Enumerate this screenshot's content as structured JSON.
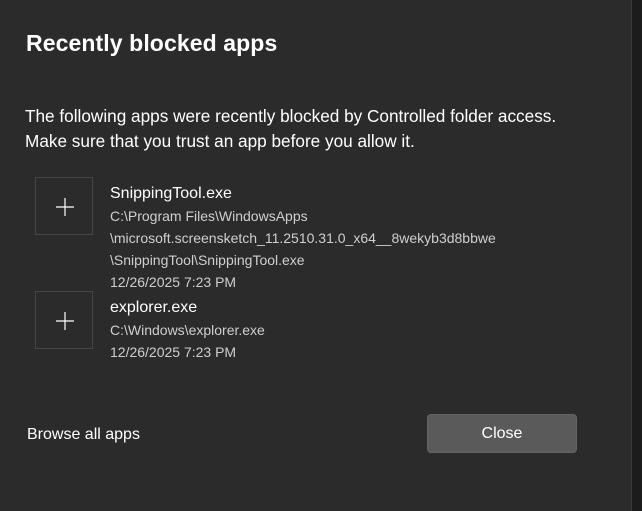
{
  "dialog": {
    "title": "Recently blocked apps",
    "description_line1": "The following apps were recently blocked by Controlled folder access.",
    "description_line2": "Make sure that you trust an app before you allow it."
  },
  "apps": [
    {
      "name": "SnippingTool.exe",
      "path_lines": [
        "C:\\Program Files\\WindowsApps",
        "\\microsoft.screensketch_11.2510.31.0_x64__8wekyb3d8bbwe",
        "\\SnippingTool\\SnippingTool.exe"
      ],
      "blocked_time": "12/26/2025 7:23 PM",
      "icon": "plus-icon"
    },
    {
      "name": "explorer.exe",
      "path_lines": [
        "C:\\Windows\\explorer.exe"
      ],
      "blocked_time": "12/26/2025 7:23 PM",
      "icon": "plus-icon"
    }
  ],
  "footer": {
    "browse_label": "Browse all apps",
    "close_label": "Close"
  },
  "colors": {
    "background": "#2b2b2b",
    "text_primary": "#ffffff",
    "text_secondary": "#cfcfcf",
    "button_bg": "#5a5a5a"
  }
}
